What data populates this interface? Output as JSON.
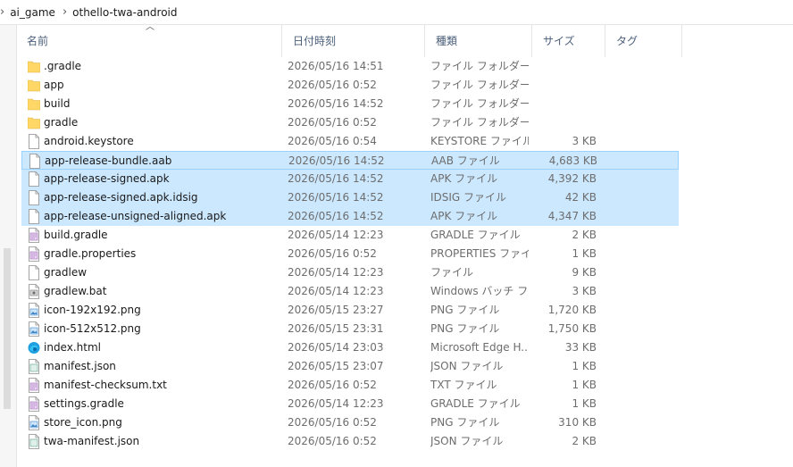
{
  "breadcrumb": [
    "ai_game",
    "othello-twa-android"
  ],
  "columns": {
    "name": "名前",
    "date": "日付時刻",
    "type": "種類",
    "size": "サイズ",
    "tag": "タグ"
  },
  "files": [
    {
      "name": ".gradle",
      "date": "2026/05/16 14:51",
      "type": "ファイル フォルダー",
      "size": "",
      "icon": "folder-icon",
      "selected": false
    },
    {
      "name": "app",
      "date": "2026/05/16 0:52",
      "type": "ファイル フォルダー",
      "size": "",
      "icon": "folder-icon",
      "selected": false
    },
    {
      "name": "build",
      "date": "2026/05/16 14:52",
      "type": "ファイル フォルダー",
      "size": "",
      "icon": "folder-icon",
      "selected": false
    },
    {
      "name": "gradle",
      "date": "2026/05/16 0:52",
      "type": "ファイル フォルダー",
      "size": "",
      "icon": "folder-icon",
      "selected": false
    },
    {
      "name": "android.keystore",
      "date": "2026/05/16 0:54",
      "type": "KEYSTORE ファイル",
      "size": "3 KB",
      "icon": "file-icon",
      "selected": false
    },
    {
      "name": "app-release-bundle.aab",
      "date": "2026/05/16 14:52",
      "type": "AAB ファイル",
      "size": "4,683 KB",
      "icon": "file-icon",
      "selected": true
    },
    {
      "name": "app-release-signed.apk",
      "date": "2026/05/16 14:52",
      "type": "APK ファイル",
      "size": "4,392 KB",
      "icon": "file-icon",
      "selected": true
    },
    {
      "name": "app-release-signed.apk.idsig",
      "date": "2026/05/16 14:52",
      "type": "IDSIG ファイル",
      "size": "42 KB",
      "icon": "file-icon",
      "selected": true
    },
    {
      "name": "app-release-unsigned-aligned.apk",
      "date": "2026/05/16 14:52",
      "type": "APK ファイル",
      "size": "4,347 KB",
      "icon": "file-icon",
      "selected": true
    },
    {
      "name": "build.gradle",
      "date": "2026/05/14 12:23",
      "type": "GRADLE ファイル",
      "size": "2 KB",
      "icon": "script-file-icon",
      "selected": false
    },
    {
      "name": "gradle.properties",
      "date": "2026/05/16 0:52",
      "type": "PROPERTIES ファイル",
      "size": "1 KB",
      "icon": "script-file-icon",
      "selected": false
    },
    {
      "name": "gradlew",
      "date": "2026/05/14 12:23",
      "type": "ファイル",
      "size": "9 KB",
      "icon": "file-icon",
      "selected": false
    },
    {
      "name": "gradlew.bat",
      "date": "2026/05/14 12:23",
      "type": "Windows バッチ ファ...",
      "size": "3 KB",
      "icon": "batch-file-icon",
      "selected": false
    },
    {
      "name": "icon-192x192.png",
      "date": "2026/05/15 23:27",
      "type": "PNG ファイル",
      "size": "1,720 KB",
      "icon": "image-file-icon",
      "selected": false
    },
    {
      "name": "icon-512x512.png",
      "date": "2026/05/15 23:31",
      "type": "PNG ファイル",
      "size": "1,750 KB",
      "icon": "image-file-icon",
      "selected": false
    },
    {
      "name": "index.html",
      "date": "2026/05/14 23:03",
      "type": "Microsoft Edge H...",
      "size": "33 KB",
      "icon": "edge-icon",
      "selected": false
    },
    {
      "name": "manifest.json",
      "date": "2026/05/15 23:07",
      "type": "JSON ファイル",
      "size": "1 KB",
      "icon": "json-file-icon",
      "selected": false
    },
    {
      "name": "manifest-checksum.txt",
      "date": "2026/05/16 0:52",
      "type": "TXT ファイル",
      "size": "1 KB",
      "icon": "script-file-icon",
      "selected": false
    },
    {
      "name": "settings.gradle",
      "date": "2026/05/14 12:23",
      "type": "GRADLE ファイル",
      "size": "1 KB",
      "icon": "script-file-icon",
      "selected": false
    },
    {
      "name": "store_icon.png",
      "date": "2026/05/16 0:52",
      "type": "PNG ファイル",
      "size": "310 KB",
      "icon": "image-file-icon",
      "selected": false
    },
    {
      "name": "twa-manifest.json",
      "date": "2026/05/16 0:52",
      "type": "JSON ファイル",
      "size": "2 KB",
      "icon": "json-file-icon",
      "selected": false
    }
  ],
  "colors": {
    "selection": "#cce8ff",
    "selection_border": "#99d1ff",
    "folder": "#ffd766",
    "header_text": "#4c607a"
  }
}
